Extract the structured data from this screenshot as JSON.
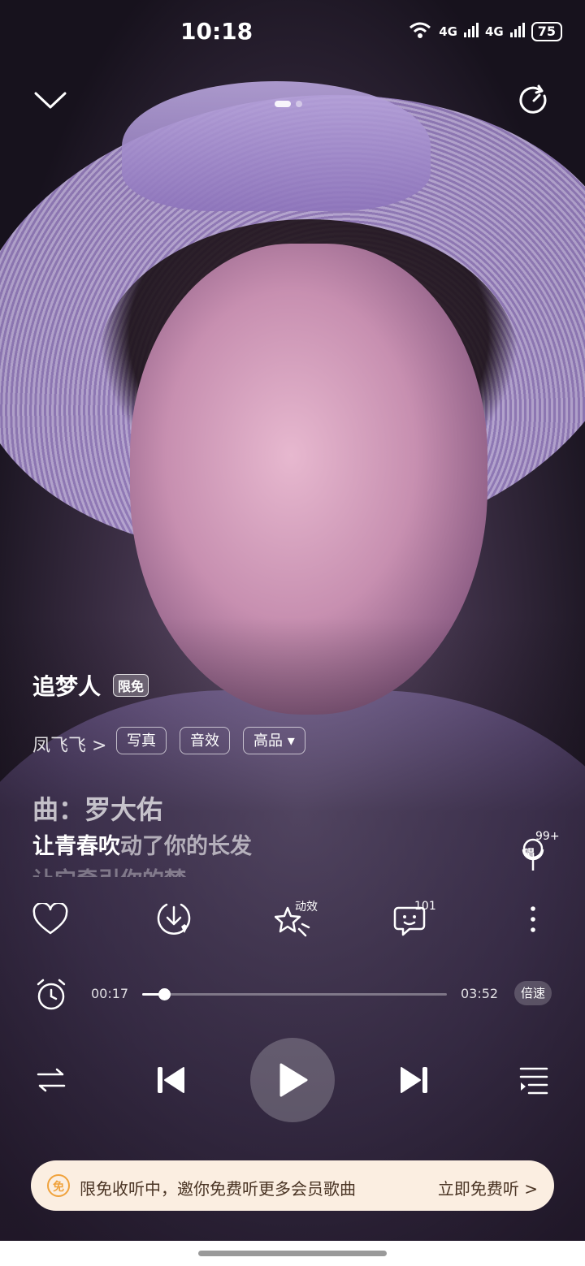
{
  "status_bar": {
    "time": "10:18",
    "wifi_label": "6",
    "sim1_label": "4G",
    "sim2_label": "4G",
    "battery": "75"
  },
  "topbar": {
    "collapse_icon": "chevron-down-icon",
    "rotate_icon": "refresh-icon"
  },
  "song": {
    "title": "追梦人",
    "free_tag": "限免",
    "artist": "凤飞飞 >",
    "chips": [
      "写真",
      "音效",
      "高品 ▾"
    ]
  },
  "lyrics": {
    "line1": "曲：罗大佑",
    "line2_sung": "让青春吹",
    "line2_rest": "动了你的长发",
    "line3": "让它牵引你的梦"
  },
  "sing": {
    "count": "99+",
    "label": "唱"
  },
  "actions": {
    "effects_label": "动效",
    "comments_count": "101"
  },
  "progress": {
    "current": "00:17",
    "total": "03:52",
    "fraction": 0.073,
    "speed_label": "倍速"
  },
  "promo": {
    "icon_label": "免",
    "text": "限免收听中，邀你免费听更多会员歌曲",
    "cta": "立即免费听 >"
  },
  "colors": {
    "accent_orange": "#f0a23c",
    "promo_bg": "#fbeee1"
  }
}
